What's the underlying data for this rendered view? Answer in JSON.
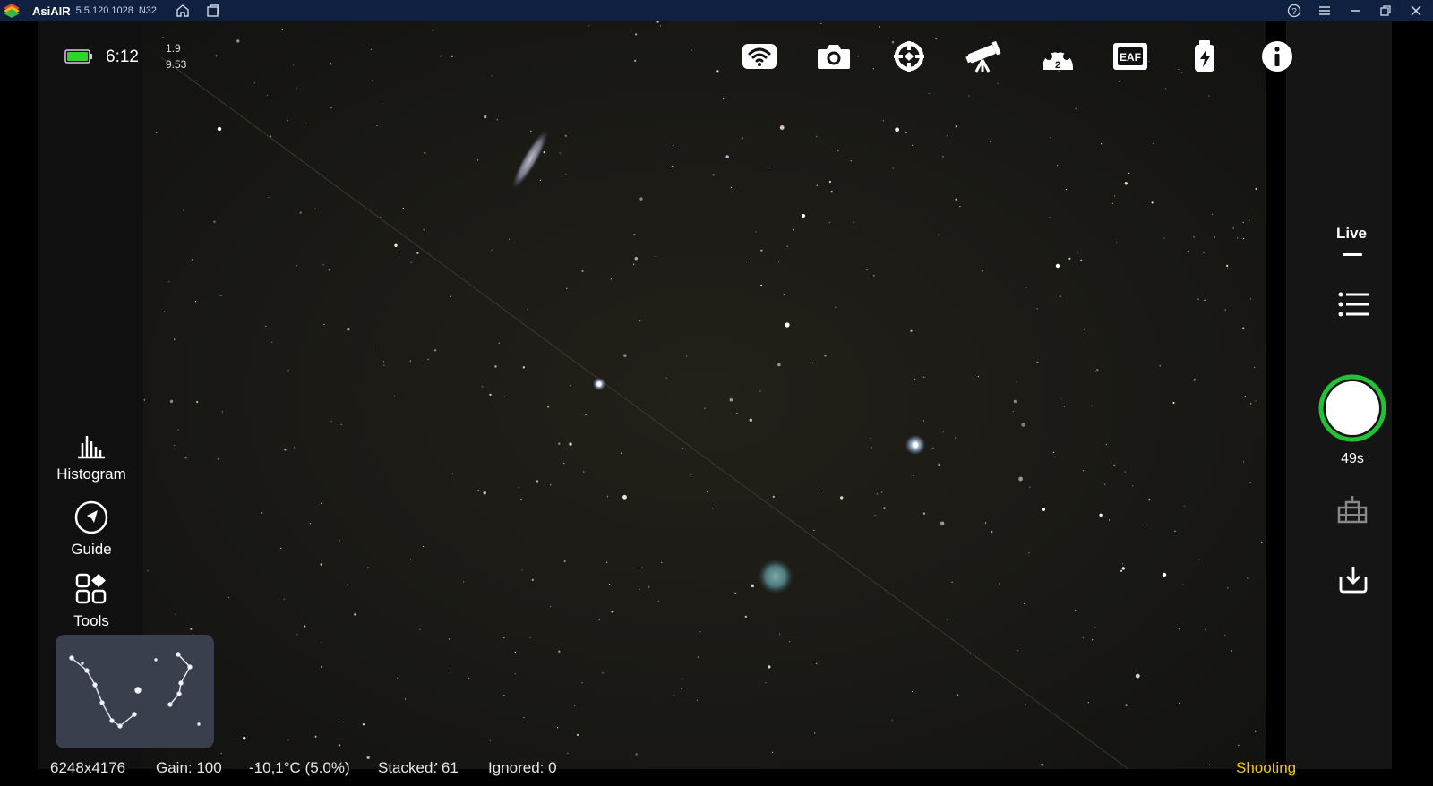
{
  "titlebar": {
    "app_name": "AsiAIR",
    "version": "5.5.120.1028",
    "arch": "N32"
  },
  "status": {
    "clock": "6:12",
    "stat_top": "1.9",
    "stat_bottom": "9.53",
    "battery_color": "#2bd62b"
  },
  "toolbar": {
    "icons": [
      "wifi-icon",
      "camera-icon",
      "guide-scope-icon",
      "telescope-icon",
      "filter-wheel-icon",
      "eaf-focuser-icon",
      "power-icon",
      "info-icon"
    ],
    "filter_wheel_slot": "2",
    "eaf_label": "EAF"
  },
  "left_tools": {
    "histogram": "Histogram",
    "guide": "Guide",
    "tools": "Tools"
  },
  "right_panel": {
    "live": "Live",
    "timer": "49s",
    "shutter_ring_color": "#21c235"
  },
  "bottom_bar": {
    "resolution": "6248x4176",
    "gain": "Gain: 100",
    "temperature": "-10,1°C  (5.0%)",
    "stacked": "Stacked: 61",
    "ignored": "Ignored: 0",
    "state": "Shooting",
    "state_color": "#f5c800"
  }
}
